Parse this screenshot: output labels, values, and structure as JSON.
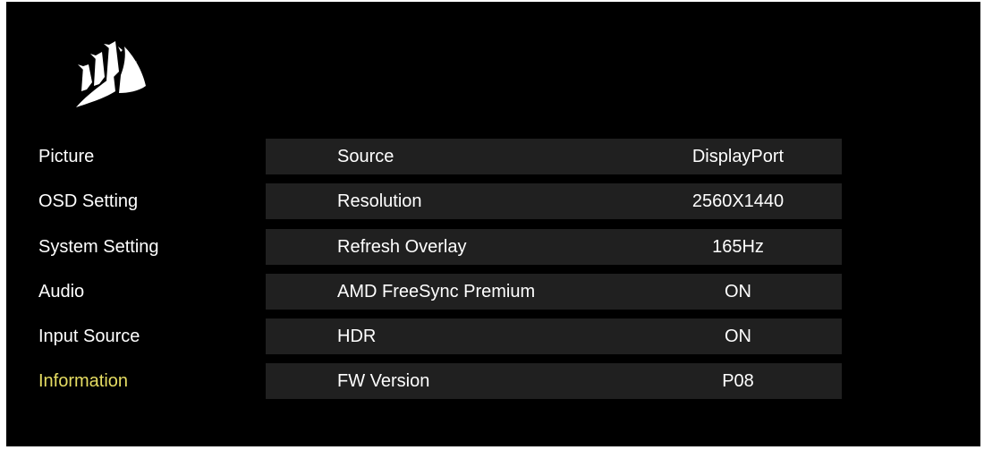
{
  "brand": {
    "logo": "corsair-sails-logo",
    "colors": {
      "background": "#000000",
      "row_background": "#202020",
      "text": "#ffffff",
      "active_text": "#e6dd63"
    }
  },
  "menu": {
    "items": [
      {
        "label": "Picture",
        "active": false
      },
      {
        "label": "OSD Setting",
        "active": false
      },
      {
        "label": "System Setting",
        "active": false
      },
      {
        "label": "Audio",
        "active": false
      },
      {
        "label": "Input Source",
        "active": false
      },
      {
        "label": "Information",
        "active": true
      }
    ]
  },
  "info": {
    "rows": [
      {
        "label": "Source",
        "value": "DisplayPort"
      },
      {
        "label": "Resolution",
        "value": "2560X1440"
      },
      {
        "label": "Refresh Overlay",
        "value": "165Hz"
      },
      {
        "label": "AMD FreeSync Premium",
        "value": "ON"
      },
      {
        "label": "HDR",
        "value": "ON"
      },
      {
        "label": "FW Version",
        "value": "P08"
      }
    ]
  }
}
